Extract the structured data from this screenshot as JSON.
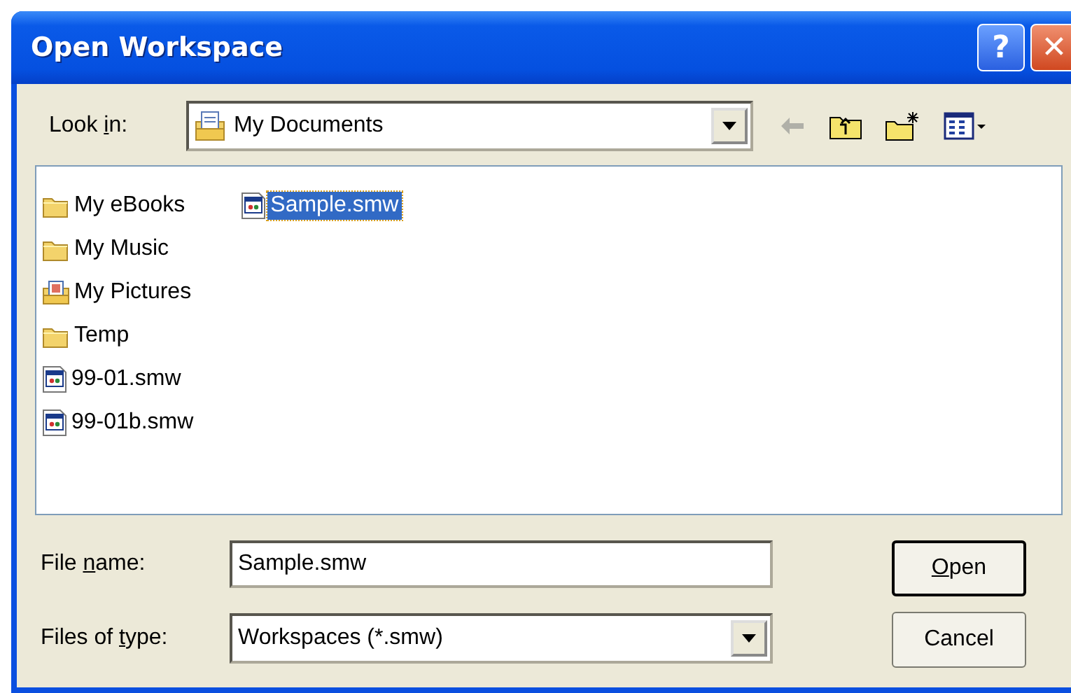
{
  "window": {
    "title": "Open Workspace",
    "help_button": "?",
    "close_button": "✕"
  },
  "look_in": {
    "label_before": "Look ",
    "access_key": "i",
    "label_after": "n:",
    "value": "My Documents"
  },
  "files": [
    {
      "name": "My eBooks",
      "kind": "folder",
      "selected": false
    },
    {
      "name": "My Music",
      "kind": "folder",
      "selected": false
    },
    {
      "name": "My Pictures",
      "kind": "pictures-folder",
      "selected": false
    },
    {
      "name": "Temp",
      "kind": "folder",
      "selected": false
    },
    {
      "name": "99-01.smw",
      "kind": "workspace-file",
      "selected": false
    },
    {
      "name": "99-01b.smw",
      "kind": "workspace-file",
      "selected": false
    },
    {
      "name": "Sample.smw",
      "kind": "workspace-file",
      "selected": true
    }
  ],
  "file_name": {
    "label_before": "File ",
    "access_key": "n",
    "label_after": "ame:",
    "value": "Sample.smw"
  },
  "file_type": {
    "label_before": "Files of ",
    "access_key": "t",
    "label_after": "ype:",
    "value": "Workspaces (*.smw)"
  },
  "buttons": [
    {
      "access_key": "O",
      "label_after": "pen",
      "default": true
    },
    {
      "label_before": "Cancel",
      "default": false
    }
  ]
}
